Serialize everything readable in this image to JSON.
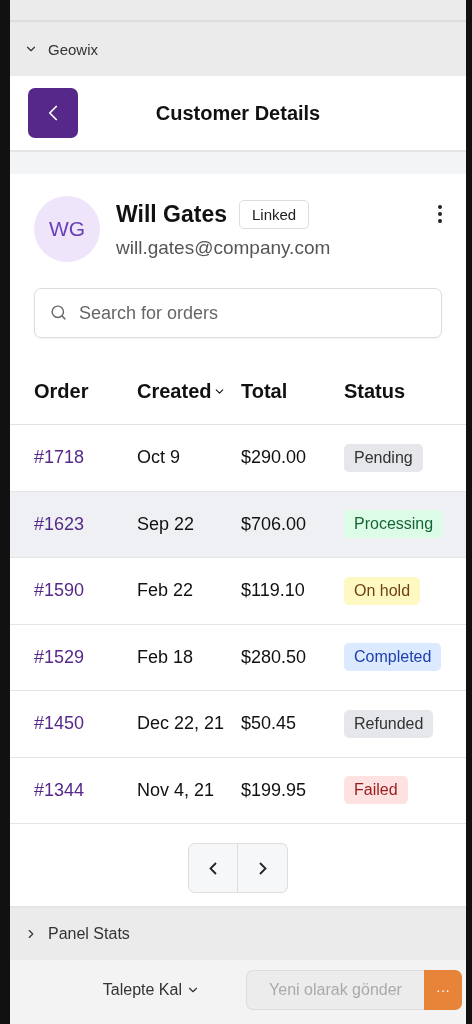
{
  "sections": [
    {
      "title": "Geowix",
      "expanded": true
    }
  ],
  "header": {
    "title": "Customer Details"
  },
  "customer": {
    "initials": "WG",
    "name": "Will Gates",
    "badge": "Linked",
    "email": "will.gates@company.com"
  },
  "search": {
    "placeholder": "Search for orders"
  },
  "table": {
    "columns": [
      {
        "label": "Order",
        "sorted": false
      },
      {
        "label": "Created",
        "sorted": true
      },
      {
        "label": "Total",
        "sorted": false
      },
      {
        "label": "Status",
        "sorted": false
      }
    ],
    "rows": [
      {
        "order": "#1718",
        "created": "Oct 9",
        "total": "$290.00",
        "status": {
          "label": "Pending",
          "kind": "neutral"
        },
        "selected": false
      },
      {
        "order": "#1623",
        "created": "Sep 22",
        "total": "$706.00",
        "status": {
          "label": "Processing",
          "kind": "success"
        },
        "selected": true
      },
      {
        "order": "#1590",
        "created": "Feb 22",
        "total": "$119.10",
        "status": {
          "label": "On hold",
          "kind": "warning"
        },
        "selected": false
      },
      {
        "order": "#1529",
        "created": "Feb 18",
        "total": "$280.50",
        "status": {
          "label": "Completed",
          "kind": "info"
        },
        "selected": false
      },
      {
        "order": "#1450",
        "created": "Dec 22, 21",
        "total": "$50.45",
        "status": {
          "label": "Refunded",
          "kind": "neutral"
        },
        "selected": false
      },
      {
        "order": "#1344",
        "created": "Nov 4, 21",
        "total": "$199.95",
        "status": {
          "label": "Failed",
          "kind": "danger"
        },
        "selected": false
      }
    ]
  },
  "footer_section": {
    "title": "Panel Stats",
    "expanded": false
  },
  "bottom_bar": {
    "dropdown": "Talepte Kal",
    "send_button": {
      "label": "Yeni olarak gönder",
      "disabled": true
    },
    "more_button": "···"
  }
}
